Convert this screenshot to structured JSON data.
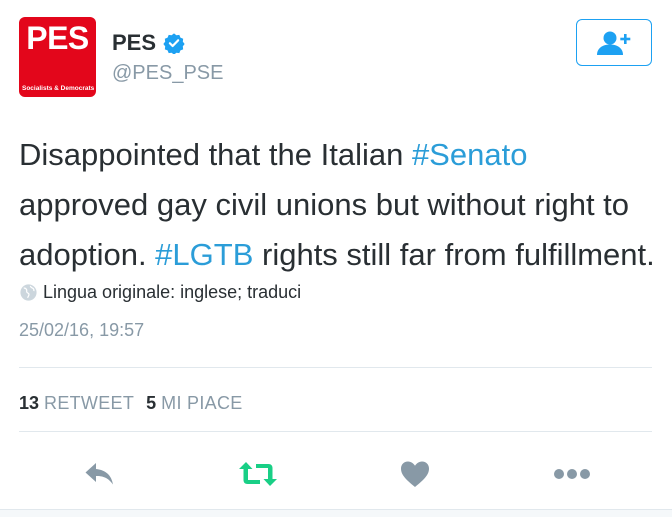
{
  "account": {
    "avatar_text": "PES",
    "avatar_subtext": "Socialists & Democrats",
    "display_name": "PES",
    "handle": "@PES_PSE",
    "verified": true
  },
  "tweet": {
    "text_parts": {
      "p1": "Disappointed that the Italian ",
      "tag1": "#Senato",
      "p2": " approved gay civil unions but without right to adoption. ",
      "tag2": "#LGTB",
      "p3": " rights still far from fulfillment."
    },
    "translation": {
      "label": "Lingua originale: inglese;",
      "link": "traduci"
    },
    "timestamp": "25/02/16, 19:57"
  },
  "stats": {
    "retweet_count": "13",
    "retweet_label": "RETWEET",
    "like_count": "5",
    "like_label": "MI PIACE"
  },
  "colors": {
    "accent": "#1da1f2",
    "hashtag": "#2b9dd8",
    "retweet_active": "#19cf86",
    "muted": "#8899a6",
    "brand_red": "#e3061b"
  },
  "icons": {
    "follow": "add-user-icon",
    "verified": "verified-badge-icon",
    "globe": "globe-icon",
    "reply": "reply-icon",
    "retweet": "retweet-icon",
    "like": "heart-icon",
    "more": "more-dots-icon"
  }
}
